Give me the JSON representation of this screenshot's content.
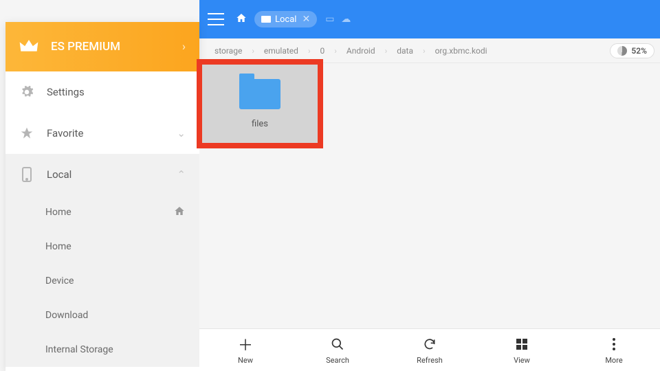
{
  "premium_label": "ES PREMIUM",
  "topbar": {
    "tab_label": "Local"
  },
  "breadcrumb": {
    "segments": [
      "storage",
      "emulated",
      "0",
      "Android",
      "data",
      "org.xbmc.kodi"
    ],
    "storage_pct": "52%"
  },
  "sidebar": {
    "settings": "Settings",
    "favorite": "Favorite",
    "local": "Local",
    "items": {
      "home1": "Home",
      "home2": "Home",
      "device": "Device",
      "download": "Download",
      "internal": "Internal Storage"
    }
  },
  "content": {
    "folder_name": "files"
  },
  "bottombar": {
    "new": "New",
    "search": "Search",
    "refresh": "Refresh",
    "view": "View",
    "more": "More"
  }
}
